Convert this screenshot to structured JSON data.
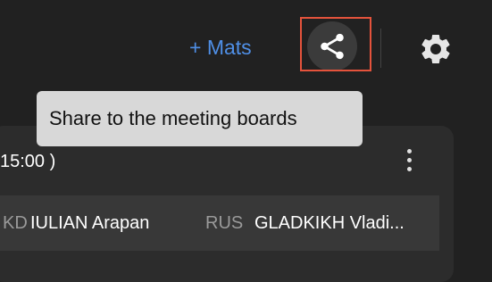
{
  "header": {
    "add_mats_label": "+ Mats",
    "share_icon": "share-icon",
    "settings_icon": "gear-icon"
  },
  "tooltip": {
    "text": "Share to the meeting boards"
  },
  "card": {
    "time_label": "15:00 )",
    "more_icon": "more-vertical-icon",
    "match": {
      "left_country": "KD",
      "left_name": "IULIAN Arapan",
      "right_country": "RUS",
      "right_name": "GLADKIKH Vladi..."
    }
  },
  "colors": {
    "background": "#212121",
    "accent": "#4f8fe6",
    "highlight": "#e5533c",
    "tooltip_bg": "#d8d8d8"
  }
}
